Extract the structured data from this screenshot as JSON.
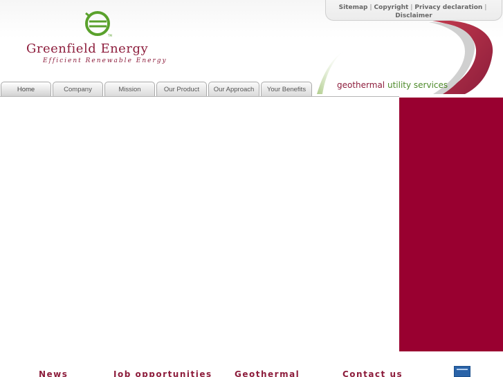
{
  "brand": {
    "name": "Greenfield Energy",
    "tagline": "Efficient Renewable Energy",
    "logo_icon": "leaf-globe-icon",
    "colors": {
      "primary": "#8d1d3c",
      "accent": "#4d8a2a",
      "panel": "#990030"
    }
  },
  "top_links": {
    "sitemap": "Sitemap",
    "copyright": "Copyright",
    "privacy": "Privacy declaration",
    "disclaimer": "Disclaimer",
    "separator": "|"
  },
  "service_tagline": {
    "part1": "geothermal",
    "part2": "utility services"
  },
  "nav": {
    "tabs": [
      {
        "label": "Home"
      },
      {
        "label": "Company"
      },
      {
        "label": "Mission"
      },
      {
        "label": "Our Product"
      },
      {
        "label": "Our Approach"
      },
      {
        "label": "Your Benefits"
      }
    ],
    "active_index": 0
  },
  "footer": {
    "links": [
      {
        "label": "News"
      },
      {
        "label": "Job opportunities"
      },
      {
        "label": "Geothermal"
      },
      {
        "label": "Contact us"
      }
    ],
    "badge_icon": "membership-badge-icon"
  }
}
